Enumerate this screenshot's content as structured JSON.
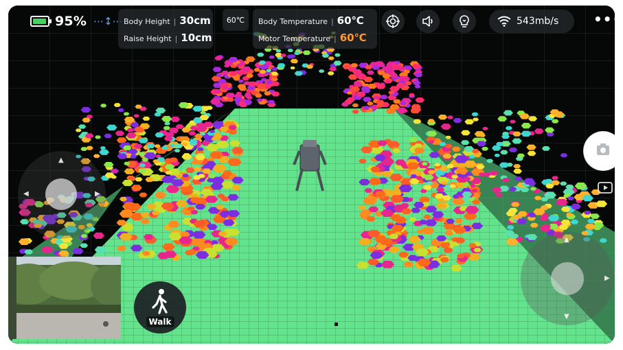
{
  "status": {
    "battery_percent": "95%",
    "battery_level": 0.95,
    "battery_color": "#46d160",
    "move_icon": "move-arrows-icon"
  },
  "robot_height": {
    "body_height_label": "Body Height",
    "body_height_value": "30cm",
    "raise_height_label": "Raise Height",
    "raise_height_value": "10cm"
  },
  "temp_chip": "60℃",
  "temperatures": {
    "body_label": "Body Temperature",
    "body_value": "60℃",
    "motor_label": "Motor Temperature",
    "motor_value": "60℃",
    "motor_value_color": "#ff9a2e"
  },
  "toolbar_icons": [
    "target-icon",
    "speaker-icon",
    "lightbulb-icon"
  ],
  "network": {
    "speed": "543mb/s",
    "icon": "wifi-icon"
  },
  "more_label": "•••",
  "walk_button": {
    "label": "Walk",
    "icon": "walking-person-icon"
  },
  "side_buttons": [
    "camera-icon",
    "record-video-icon"
  ]
}
